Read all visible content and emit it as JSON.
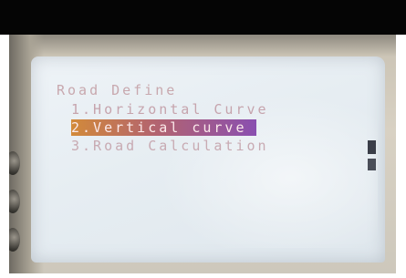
{
  "menu": {
    "title": "Road Define",
    "items": [
      {
        "label": "1.Horizontal Curve",
        "selected": false
      },
      {
        "label": "2.Vertical curve",
        "selected": true
      },
      {
        "label": "3.Road Calculation",
        "selected": false
      }
    ]
  },
  "scrollbar": {
    "icon": "scrollbar-indicator"
  },
  "colors": {
    "screen_background": "#e6edf2",
    "menu_text": "#c6a4ad",
    "selection_highlight": "#8a4fb0",
    "top_bar": "#050505"
  }
}
